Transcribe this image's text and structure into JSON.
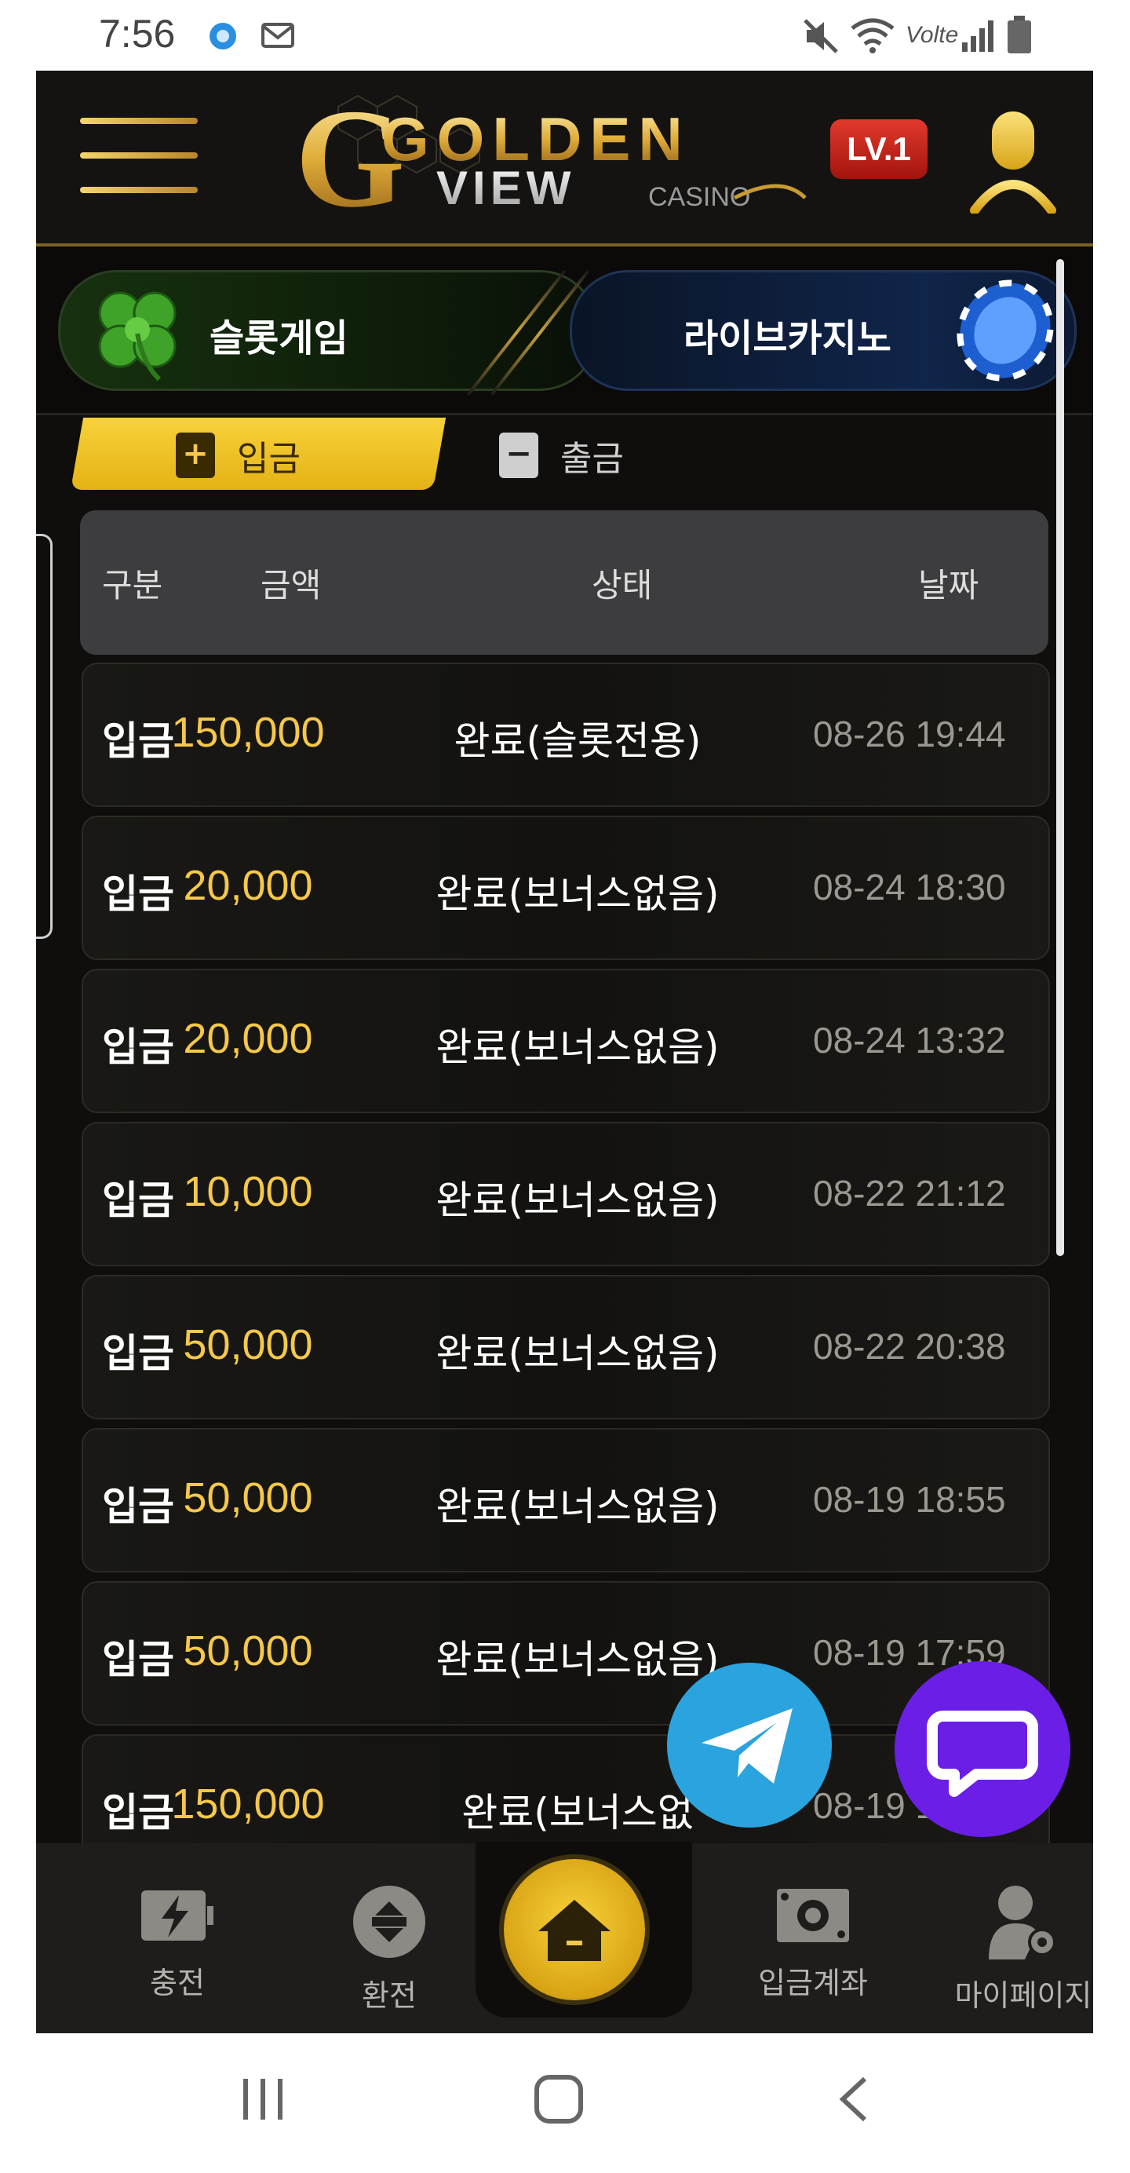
{
  "status_bar": {
    "time": "7:56",
    "network": "Volte"
  },
  "header": {
    "logo_main": "GOLDEN",
    "logo_sub": "VIEW",
    "logo_casino": "CASINO",
    "level": "LV.1"
  },
  "categories": [
    {
      "label": "슬롯게임"
    },
    {
      "label": "라이브카지노"
    }
  ],
  "tabs": {
    "deposit": "입금",
    "withdraw": "출금"
  },
  "table": {
    "headers": {
      "type": "구분",
      "amount": "금액",
      "status": "상태",
      "date": "날짜"
    },
    "rows": [
      {
        "type": "입금",
        "amount": "150,000",
        "status": "완료(슬롯전용)",
        "date": "08-26 19:44"
      },
      {
        "type": "입금",
        "amount": "20,000",
        "status": "완료(보너스없음)",
        "date": "08-24 18:30"
      },
      {
        "type": "입금",
        "amount": "20,000",
        "status": "완료(보너스없음)",
        "date": "08-24 13:32"
      },
      {
        "type": "입금",
        "amount": "10,000",
        "status": "완료(보너스없음)",
        "date": "08-22 21:12"
      },
      {
        "type": "입금",
        "amount": "50,000",
        "status": "완료(보너스없음)",
        "date": "08-22 20:38"
      },
      {
        "type": "입금",
        "amount": "50,000",
        "status": "완료(보너스없음)",
        "date": "08-19 18:55"
      },
      {
        "type": "입금",
        "amount": "50,000",
        "status": "완료(보너스없음)",
        "date": "08-19 17:59"
      },
      {
        "type": "입금",
        "amount": "150,000",
        "status": "완료(보너스없",
        "date": "08-19 1"
      }
    ]
  },
  "bottom_nav": [
    {
      "label": "충전",
      "icon": "charge-icon"
    },
    {
      "label": "환전",
      "icon": "exchange-icon"
    },
    {
      "label": "",
      "icon": "home-icon"
    },
    {
      "label": "입금계좌",
      "icon": "account-icon"
    },
    {
      "label": "마이페이지",
      "icon": "mypage-icon"
    }
  ],
  "colors": {
    "accent_gold": "#f6c84a",
    "tab_yellow": "#f2c72a",
    "telegram": "#2aa3de",
    "chat": "#6a1ee6"
  }
}
